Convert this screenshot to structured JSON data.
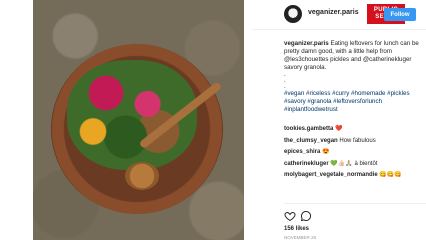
{
  "post": {
    "username": "veganizer.paris",
    "follow_label": "Follow",
    "badge": {
      "line1": "PUBLIC",
      "line2": "SENAT"
    },
    "caption": {
      "author": "veganizer.paris",
      "text": "Eating leftovers for lunch can be pretty damn good, with a little help from @les3chouettes pickles and @catherinekluger savory granola.",
      "dots": [
        ".",
        ".",
        "."
      ],
      "hashtags": "#vegan #riceless #curry #homemade #pickles #savory #granola #leftoversforlunch #inplantfoodwetrust"
    },
    "comments": [
      {
        "user": "tookies.gambetta",
        "text": "❤️"
      },
      {
        "user": "the_clumsy_vegan",
        "text": "How fabulous"
      },
      {
        "user": "epices_shira",
        "text": "😍"
      },
      {
        "user": "catherinekluger",
        "text": "💚👍🏻🙏🏼 à bientôt"
      },
      {
        "user": "molybagert_vegetale_normandie",
        "text": "😋😋😋"
      }
    ],
    "likes": "156 likes",
    "date": "NOVEMBER 28"
  },
  "icons": {
    "like": "heart-icon",
    "comment": "comment-icon",
    "avatar": "avatar"
  },
  "colors": {
    "badge_red": "#d4101e",
    "follow_blue": "#3897f0",
    "hashtag_blue": "#003569"
  }
}
